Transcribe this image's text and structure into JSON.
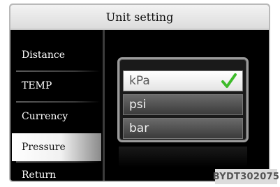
{
  "title": "Unit setting",
  "menu": [
    {
      "label": "Distance",
      "selected": false
    },
    {
      "label": "TEMP",
      "selected": false
    },
    {
      "label": "Currency",
      "selected": false
    },
    {
      "label": "Pressure",
      "selected": true
    },
    {
      "label": "Return",
      "selected": false
    }
  ],
  "options": [
    {
      "label": "kPa",
      "selected": true
    },
    {
      "label": "psi",
      "selected": false
    },
    {
      "label": "bar",
      "selected": false
    }
  ],
  "colors": {
    "check": "#3dbb2a"
  },
  "watermark": "BYDT302075"
}
